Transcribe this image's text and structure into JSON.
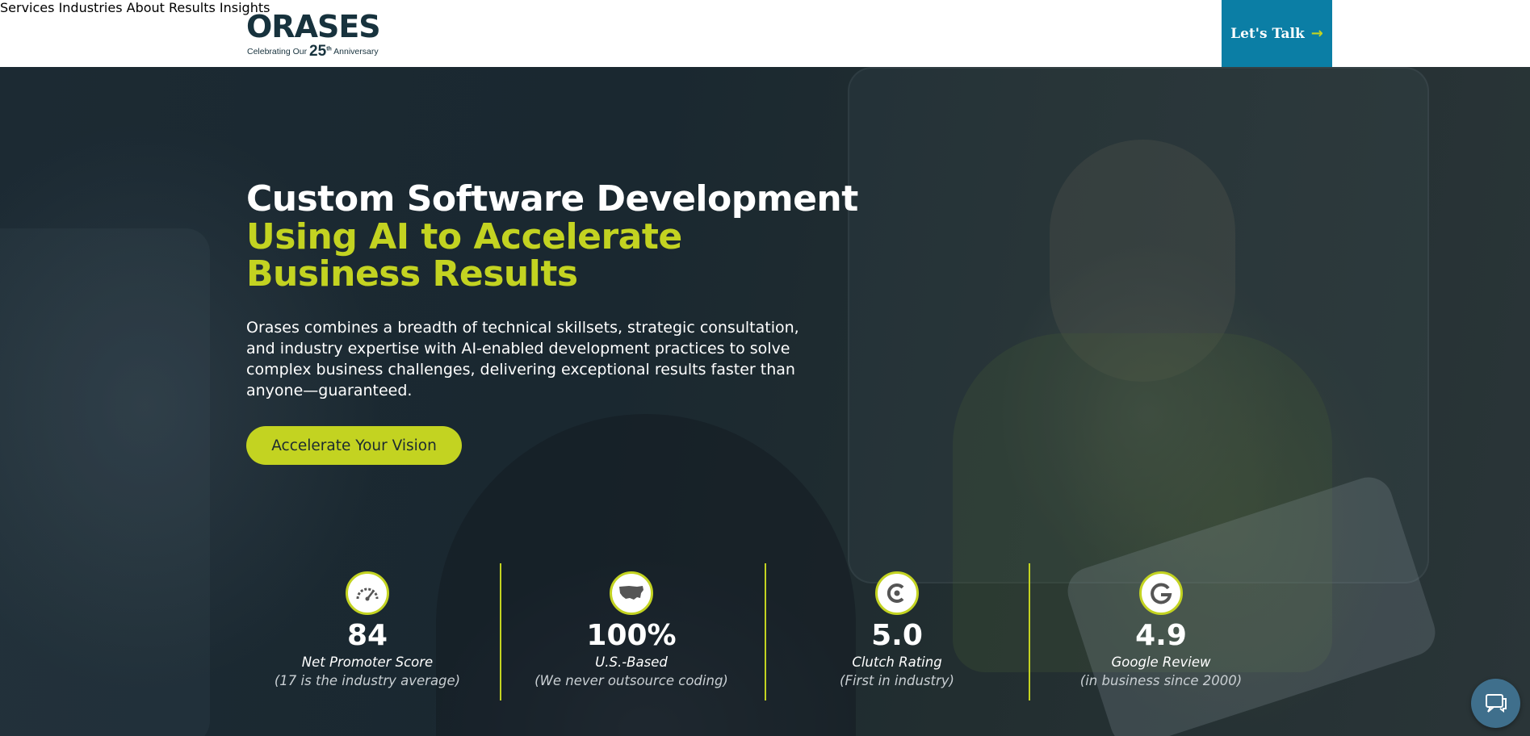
{
  "header": {
    "logo_text": "ORASES",
    "logo_tagline_pre": "Celebrating Our",
    "logo_tagline_num": "25",
    "logo_tagline_sup": "th",
    "logo_tagline_post": "Anniversary",
    "nav": [
      "Services",
      "Industries",
      "About",
      "Results",
      "Insights"
    ],
    "cta_label": "Let's Talk",
    "cta_icon": "arrow-right-icon"
  },
  "hero": {
    "title_line1": "Custom Software Development",
    "title_line2": "Using AI to Accelerate Business Results",
    "intro": "Orases combines a breadth of technical skillsets, strategic consultation, and industry expertise with AI-enabled development practices to solve complex business challenges, delivering exceptional results faster than anyone—guaranteed.",
    "button_label": "Accelerate Your Vision"
  },
  "stats": [
    {
      "icon": "gauge-icon",
      "value": "84",
      "label": "Net Promoter Score",
      "sub": "(17 is the industry average)"
    },
    {
      "icon": "usa-map-icon",
      "value": "100%",
      "label": "U.S.-Based",
      "sub": "(We never outsource coding)"
    },
    {
      "icon": "clutch-logo-icon",
      "value": "5.0",
      "label": "Clutch Rating",
      "sub": "(First in industry)"
    },
    {
      "icon": "google-logo-icon",
      "value": "4.9",
      "label": "Google Review",
      "sub": "(in business since 2000)"
    }
  ],
  "colors": {
    "accent": "#c3d321",
    "cta": "#0b7ea5",
    "header_bg": "#ffffff",
    "hero_bg": "#1f2b33"
  },
  "chat_icon": "chat-bubble-icon"
}
